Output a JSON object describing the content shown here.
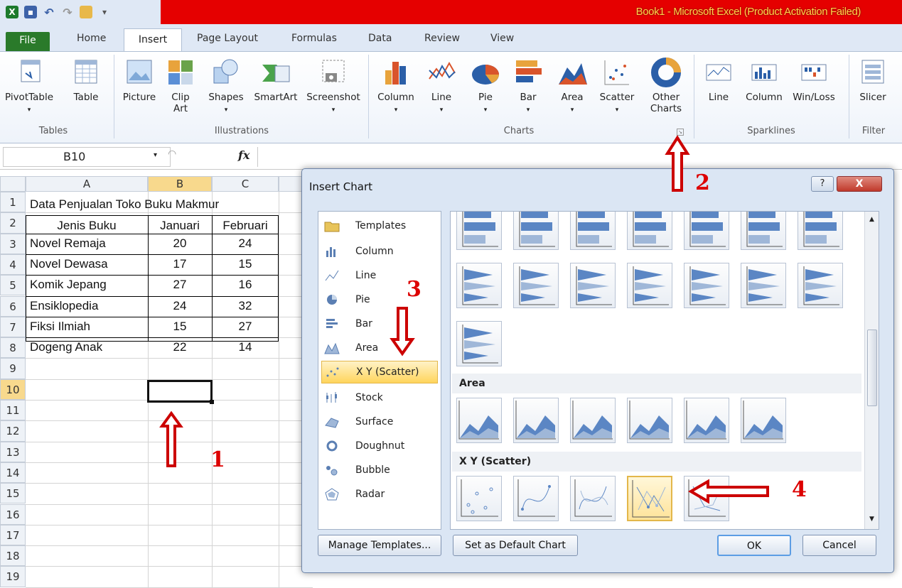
{
  "titlebar": {
    "title": "Book1  -  Microsoft Excel (Product Activation Failed)",
    "accent": "#e50000"
  },
  "tabs": [
    "File",
    "Home",
    "Insert",
    "Page Layout",
    "Formulas",
    "Data",
    "Review",
    "View"
  ],
  "ribbon": {
    "tables": {
      "label": "Tables",
      "buttons": [
        {
          "label": "PivotTable",
          "icon": "pivottable-icon"
        },
        {
          "label": "Table",
          "icon": "table-icon"
        }
      ]
    },
    "illustrations": {
      "label": "Illustrations",
      "buttons": [
        {
          "label": "Picture"
        },
        {
          "label": "Clip Art"
        },
        {
          "label": "Shapes"
        },
        {
          "label": "SmartArt"
        },
        {
          "label": "Screenshot"
        }
      ]
    },
    "charts": {
      "label": "Charts",
      "buttons": [
        {
          "label": "Column"
        },
        {
          "label": "Line"
        },
        {
          "label": "Pie"
        },
        {
          "label": "Bar"
        },
        {
          "label": "Area"
        },
        {
          "label": "Scatter"
        },
        {
          "label": "Other Charts"
        }
      ]
    },
    "sparklines": {
      "label": "Sparklines",
      "buttons": [
        {
          "label": "Line"
        },
        {
          "label": "Column"
        },
        {
          "label": "Win/Loss"
        }
      ]
    },
    "filter": {
      "label": "Filter",
      "buttons": [
        {
          "label": "Slicer"
        }
      ]
    }
  },
  "formula_bar": {
    "name_box": "B10",
    "fx": "fx"
  },
  "sheet": {
    "columns": [
      "A",
      "B",
      "C"
    ],
    "rows": [
      "1",
      "2",
      "3",
      "4",
      "5",
      "6",
      "7",
      "8",
      "9",
      "10",
      "11",
      "12",
      "13",
      "14",
      "15",
      "16",
      "17",
      "18",
      "19"
    ],
    "title": "Data Penjualan Toko Buku Makmur",
    "headers": [
      "Jenis Buku",
      "Januari",
      "Februari"
    ],
    "data": [
      [
        "Novel Remaja",
        "20",
        "24"
      ],
      [
        "Novel Dewasa",
        "17",
        "15"
      ],
      [
        "Komik Jepang",
        "27",
        "16"
      ],
      [
        "Ensiklopedia",
        "24",
        "32"
      ],
      [
        "Fiksi Ilmiah",
        "15",
        "27"
      ],
      [
        "Dogeng Anak",
        "22",
        "14"
      ]
    ]
  },
  "dialog": {
    "title": "Insert Chart",
    "help": "?",
    "close": "X",
    "categories": [
      "Templates",
      "Column",
      "Line",
      "Pie",
      "Bar",
      "Area",
      "X Y (Scatter)",
      "Stock",
      "Surface",
      "Doughnut",
      "Bubble",
      "Radar"
    ],
    "selected_category": "X Y (Scatter)",
    "sections": {
      "area": "Area",
      "scatter": "X Y (Scatter)"
    },
    "buttons": {
      "manage": "Manage Templates...",
      "default": "Set as Default Chart",
      "ok": "OK",
      "cancel": "Cancel"
    }
  },
  "annotations": [
    "1",
    "2",
    "3",
    "4"
  ]
}
